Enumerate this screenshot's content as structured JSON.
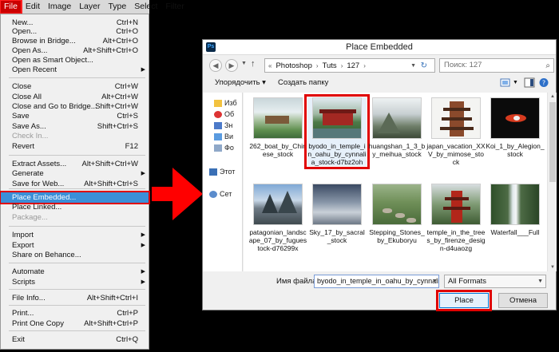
{
  "menubar": {
    "items": [
      {
        "label": "File",
        "active": true
      },
      {
        "label": "Edit"
      },
      {
        "label": "Image"
      },
      {
        "label": "Layer"
      },
      {
        "label": "Type"
      },
      {
        "label": "Select"
      },
      {
        "label": "Filter"
      }
    ]
  },
  "file_menu": {
    "items": [
      {
        "label": "New...",
        "shortcut": "Ctrl+N"
      },
      {
        "label": "Open...",
        "shortcut": "Ctrl+O"
      },
      {
        "label": "Browse in Bridge...",
        "shortcut": "Alt+Ctrl+O"
      },
      {
        "label": "Open As...",
        "shortcut": "Alt+Shift+Ctrl+O"
      },
      {
        "label": "Open as Smart Object..."
      },
      {
        "label": "Open Recent",
        "submenu": true
      },
      {
        "label": "Close",
        "shortcut": "Ctrl+W"
      },
      {
        "label": "Close All",
        "shortcut": "Alt+Ctrl+W"
      },
      {
        "label": "Close and Go to Bridge...",
        "shortcut": "Shift+Ctrl+W"
      },
      {
        "label": "Save",
        "shortcut": "Ctrl+S"
      },
      {
        "label": "Save As...",
        "shortcut": "Shift+Ctrl+S"
      },
      {
        "label": "Check In...",
        "disabled": true
      },
      {
        "label": "Revert",
        "shortcut": "F12"
      },
      {
        "label": "Extract Assets...",
        "shortcut": "Alt+Shift+Ctrl+W"
      },
      {
        "label": "Generate",
        "submenu": true
      },
      {
        "label": "Save for Web...",
        "shortcut": "Alt+Shift+Ctrl+S"
      },
      {
        "label": "Place Embedded...",
        "highlighted": true
      },
      {
        "label": "Place Linked..."
      },
      {
        "label": "Package...",
        "disabled": true
      },
      {
        "label": "Import",
        "submenu": true
      },
      {
        "label": "Export",
        "submenu": true
      },
      {
        "label": "Share on Behance..."
      },
      {
        "label": "Automate",
        "submenu": true
      },
      {
        "label": "Scripts",
        "submenu": true
      },
      {
        "label": "File Info...",
        "shortcut": "Alt+Shift+Ctrl+I"
      },
      {
        "label": "Print...",
        "shortcut": "Ctrl+P"
      },
      {
        "label": "Print One Copy",
        "shortcut": "Alt+Shift+Ctrl+P"
      },
      {
        "label": "Exit",
        "shortcut": "Ctrl+Q"
      }
    ]
  },
  "dialog": {
    "app_badge": "Ps",
    "title": "Place Embedded",
    "breadcrumb": [
      "Photoshop",
      "Tuts",
      "127"
    ],
    "search_placeholder": "Поиск: 127",
    "toolbar": {
      "organize": "Упорядочить",
      "new_folder": "Создать папку"
    },
    "nav_pane": [
      "Изб",
      "Об",
      "Зн",
      "Ви",
      "Фо",
      "Этот",
      "Сет"
    ],
    "files": [
      {
        "name": "262_boat_by_Chinese_stock",
        "scene": "boat"
      },
      {
        "name": "byodo_in_temple_in_oahu_by_cynnalia_stock-d7bz2oh",
        "scene": "temple",
        "selected": true
      },
      {
        "name": "huangshan_1_3_by_meihua_stock",
        "scene": "mountain"
      },
      {
        "name": "japan_vacation_XXV_by_mimose_stock",
        "scene": "pagoda"
      },
      {
        "name": "Koi_1_by_Alegion_stock",
        "scene": "koi"
      },
      {
        "name": "patagonian_landscape_07_by_fuguestock-d76299x",
        "scene": "patagonia"
      },
      {
        "name": "Sky_17_by_sacral_stock",
        "scene": "sky"
      },
      {
        "name": "Stepping_Stones_by_Ekuboryu",
        "scene": "stones"
      },
      {
        "name": "temple_in_the_trees_by_firenze_design-d4uaozg",
        "scene": "redpagoda"
      },
      {
        "name": "Waterfall___Full",
        "scene": "waterfall"
      }
    ],
    "filename_label": "Имя файла:",
    "filename_value": "byodo_in_temple_in_oahu_by_cynnalia",
    "format_value": "All Formats",
    "place_label": "Place",
    "cancel_label": "Отмена"
  },
  "colors": {
    "highlight_red": "#e00000",
    "menu_select": "#3b8fd8",
    "arrow_red": "#ff0000"
  }
}
